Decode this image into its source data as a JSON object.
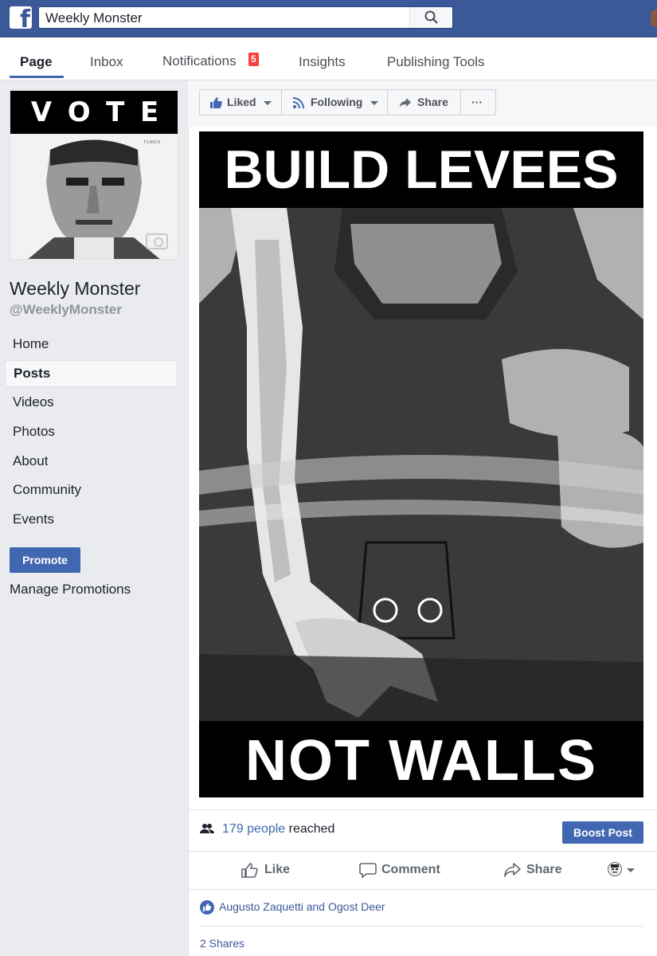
{
  "topbar": {
    "logo": "f",
    "search_value": "Weekly Monster"
  },
  "tabs": [
    {
      "label": "Page"
    },
    {
      "label": "Inbox"
    },
    {
      "label": "Notifications",
      "badge": "5"
    },
    {
      "label": "Insights"
    },
    {
      "label": "Publishing Tools"
    }
  ],
  "sidebar": {
    "profile_vote": [
      "V",
      "O",
      "T",
      "E"
    ],
    "page_name": "Weekly Monster",
    "handle": "@WeeklyMonster",
    "nav": [
      "Home",
      "Posts",
      "Videos",
      "Photos",
      "About",
      "Community",
      "Events"
    ],
    "promote": "Promote",
    "manage_promotions": "Manage Promotions"
  },
  "actions": {
    "liked": "Liked",
    "following": "Following",
    "share": "Share",
    "more": "···"
  },
  "post": {
    "poster_top": "BUILD LEVEES",
    "poster_bottom": "NOT WALLS",
    "reach_count": "179 people",
    "reach_suffix": " reached",
    "boost": "Boost Post",
    "like": "Like",
    "comment": "Comment",
    "share": "Share",
    "likers": "Augusto Zaquetti and Ogost Deer",
    "shares": "2 Shares"
  },
  "colors": {
    "brand": "#3b5998",
    "accent": "#4267b2",
    "badge": "#fa3e3e"
  }
}
